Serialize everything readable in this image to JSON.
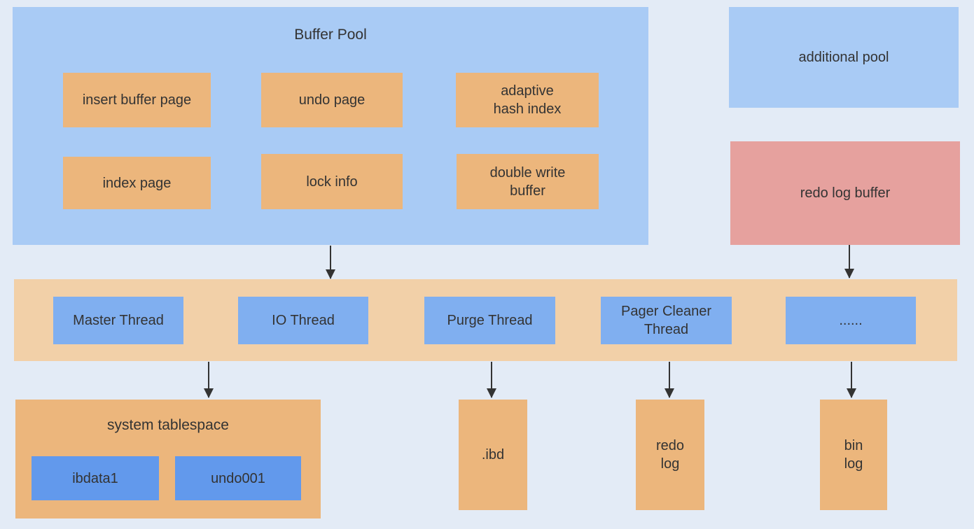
{
  "buffer_pool": {
    "title": "Buffer Pool",
    "items": [
      "insert buffer page",
      "undo page",
      "adaptive hash index",
      "index page",
      "lock info",
      "double write buffer"
    ]
  },
  "additional_pool": "additional pool",
  "redo_log_buffer": "redo log buffer",
  "threads": [
    "Master Thread",
    "IO Thread",
    "Purge Thread",
    "Pager Cleaner Thread",
    "......"
  ],
  "system_tablespace": {
    "title": "system tablespace",
    "files": [
      "ibdata1",
      "undo001"
    ]
  },
  "files": [
    ".ibd",
    "redo log",
    "bin log"
  ],
  "colors": {
    "background": "#e3ebf6",
    "buffer_pool": "#a9cbf5",
    "page_box": "#ecb67c",
    "thread_bar": "#f2d0a8",
    "thread_box": "#80aff0",
    "file_box": "#6299ec",
    "redo_log_buffer": "#e6a19e"
  }
}
